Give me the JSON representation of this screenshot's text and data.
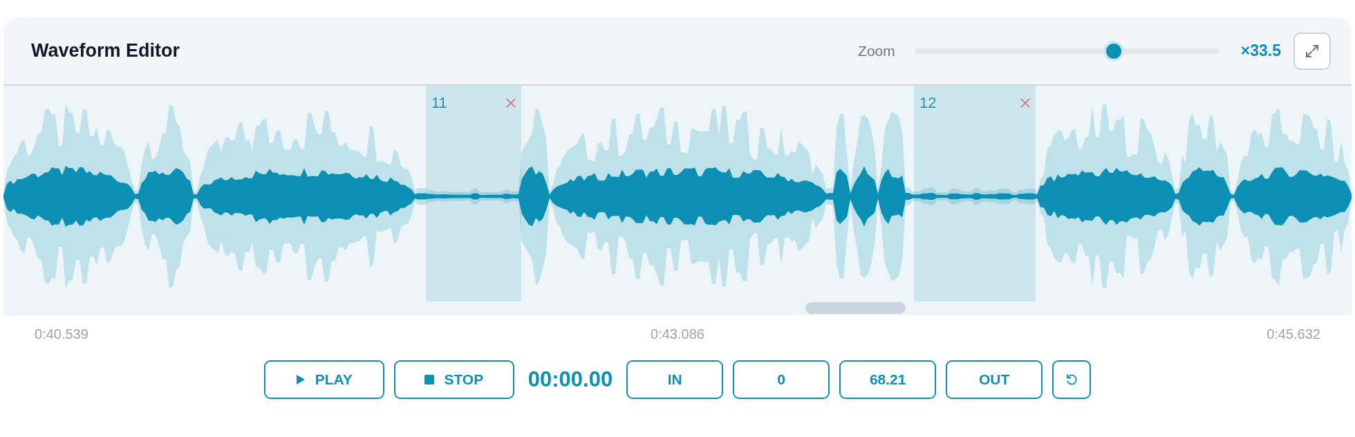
{
  "header": {
    "title": "Waveform Editor",
    "zoom": {
      "label": "Zoom",
      "level": 0.65,
      "value": "×33.5"
    }
  },
  "regions": [
    {
      "label": "11"
    },
    {
      "label": "12"
    }
  ],
  "timeline": [
    "0:40.539",
    "0:43.086",
    "0:45.632"
  ],
  "transport": [
    {
      "kind": "play",
      "label": "PLAY"
    },
    {
      "kind": "stop",
      "label": "STOP"
    },
    {
      "kind": "time",
      "label": "00:00.00"
    },
    {
      "kind": "text",
      "label": "IN"
    },
    {
      "kind": "text",
      "label": "0"
    },
    {
      "kind": "text",
      "label": "68.21"
    },
    {
      "kind": "text",
      "label": "OUT"
    },
    {
      "kind": "reset"
    }
  ]
}
